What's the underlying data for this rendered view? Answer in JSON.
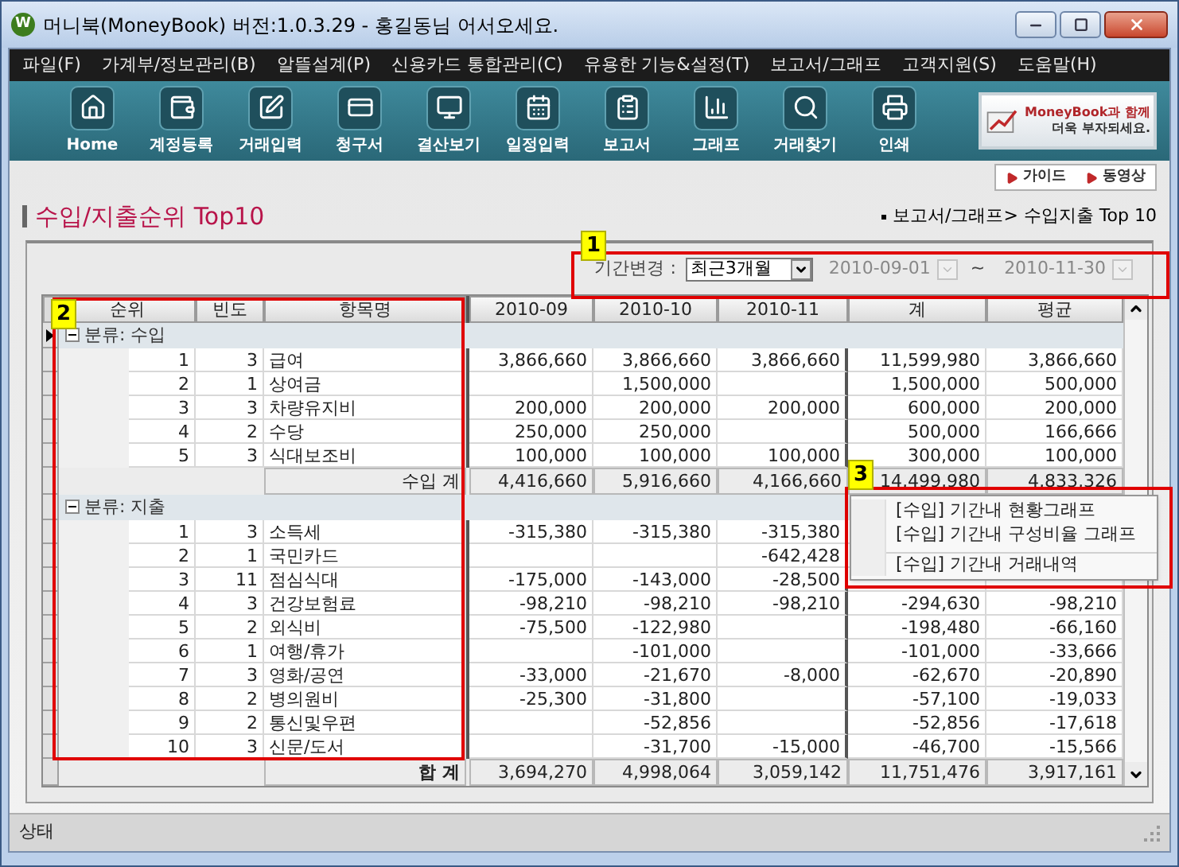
{
  "window": {
    "logo": "W",
    "title": "머니북(MoneyBook) 버전:1.0.3.29 - 홍길동님 어서오세요."
  },
  "menu": [
    "파일(F)",
    "가계부/정보관리(B)",
    "알뜰설계(P)",
    "신용카드 통합관리(C)",
    "유용한 기능&설정(T)",
    "보고서/그래프",
    "고객지원(S)",
    "도움말(H)"
  ],
  "toolbar": [
    "Home",
    "계정등록",
    "거래입력",
    "청구서",
    "결산보기",
    "일정입력",
    "보고서",
    "그래프",
    "거래찾기",
    "인쇄"
  ],
  "banner": {
    "line_1": "MoneyBook과 함께",
    "line_2": "더욱 부자되세요."
  },
  "help_buttons": [
    "가이드",
    "동영상"
  ],
  "page_title": "수입/지출순위 Top10",
  "breadcrumb": "보고서/그래프> 수입지출 Top 10",
  "filter": {
    "label": "기간변경 :",
    "period": "최근3개월",
    "start": {
      "value": "2010-09-01",
      "disabled": true
    },
    "separator": "~",
    "end": {
      "value": "2010-11-30",
      "disabled": true
    }
  },
  "table": {
    "columns": [
      "순위",
      "빈도",
      "항목명",
      "2010-09",
      "2010-10",
      "2010-11",
      "계",
      "평균"
    ],
    "groups": [
      {
        "label": "분류: 수입",
        "selected": true,
        "expanded": true,
        "rows": [
          [
            "1",
            "3",
            "급여",
            "3,866,660",
            "3,866,660",
            "3,866,660",
            "11,599,980",
            "3,866,660"
          ],
          [
            "2",
            "1",
            "상여금",
            null,
            "1,500,000",
            null,
            "1,500,000",
            "500,000"
          ],
          [
            "3",
            "3",
            "차량유지비",
            "200,000",
            "200,000",
            "200,000",
            "600,000",
            "200,000"
          ],
          [
            "4",
            "2",
            "수당",
            "250,000",
            "250,000",
            null,
            "500,000",
            "166,666"
          ],
          [
            "5",
            "3",
            "식대보조비",
            "100,000",
            "100,000",
            "100,000",
            "300,000",
            "100,000"
          ]
        ],
        "subtotal": {
          "label": "수입 계",
          "values": [
            "4,416,660",
            "5,916,660",
            "4,166,660",
            "14,499,980",
            "4,833,326"
          ]
        }
      },
      {
        "label": "분류: 지출",
        "selected": false,
        "expanded": true,
        "rows": [
          [
            "1",
            "3",
            "소득세",
            "-315,380",
            "-315,380",
            "-315,380",
            null,
            null
          ],
          [
            "2",
            "1",
            "국민카드",
            null,
            null,
            "-642,428",
            null,
            null
          ],
          [
            "3",
            "11",
            "점심식대",
            "-175,000",
            "-143,000",
            "-28,500",
            null,
            null
          ],
          [
            "4",
            "3",
            "건강보험료",
            "-98,210",
            "-98,210",
            "-98,210",
            "-294,630",
            "-98,210"
          ],
          [
            "5",
            "2",
            "외식비",
            "-75,500",
            "-122,980",
            null,
            "-198,480",
            "-66,160"
          ],
          [
            "6",
            "1",
            "여행/휴가",
            null,
            "-101,000",
            null,
            "-101,000",
            "-33,666"
          ],
          [
            "7",
            "3",
            "영화/공연",
            "-33,000",
            "-21,670",
            "-8,000",
            "-62,670",
            "-20,890"
          ],
          [
            "8",
            "2",
            "병의원비",
            "-25,300",
            "-31,800",
            null,
            "-57,100",
            "-19,033"
          ],
          [
            "9",
            "2",
            "통신및우편",
            null,
            "-52,856",
            null,
            "-52,856",
            "-17,618"
          ],
          [
            "10",
            "3",
            "신문/도서",
            null,
            "-31,700",
            "-15,000",
            "-46,700",
            "-15,566"
          ]
        ]
      }
    ],
    "total": {
      "label": "합 계",
      "values": [
        "3,694,270",
        "4,998,064",
        "3,059,142",
        "11,751,476",
        "3,917,161"
      ]
    }
  },
  "context_menu": [
    {
      "label": "[수입] 기간내 현황그래프",
      "separator_before": false
    },
    {
      "label": "[수입] 기간내 구성비율 그래프",
      "separator_before": false
    },
    {
      "label": "[수입] 기간내 거래내역",
      "separator_before": true
    }
  ],
  "callouts": [
    "1",
    "2",
    "3"
  ],
  "status_bar": "상태"
}
